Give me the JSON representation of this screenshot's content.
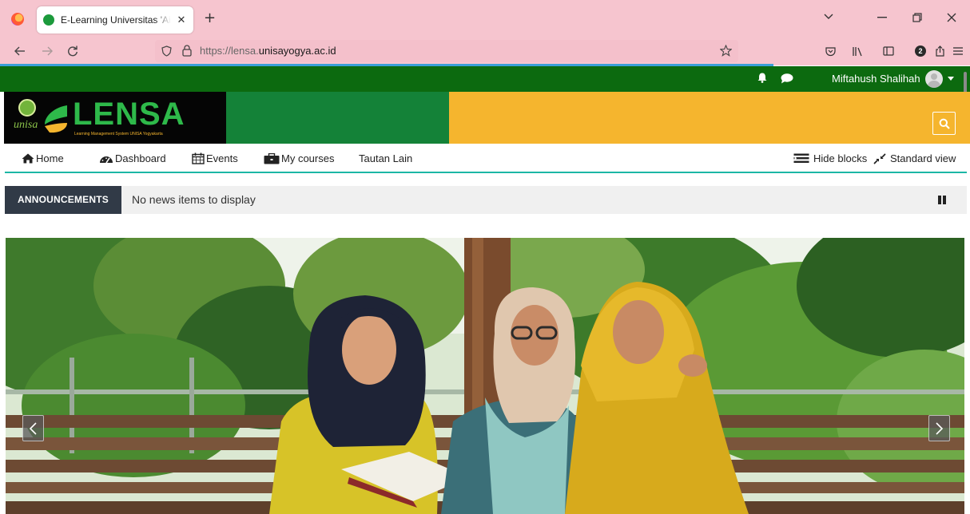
{
  "browser": {
    "tab_title": "E-Learning Universitas 'Aisyiyah Yogyakarta",
    "tab_close": "✕",
    "new_tab": "+",
    "url_prefix": "https://lensa.",
    "url_domain": "unisayogya.ac.id",
    "profile_initial": "2"
  },
  "header": {
    "username": "Miftahush Shalihah",
    "logo_seal_text": "unisa",
    "logo_text": "LENSA",
    "logo_tagline": "Learning Management System UNISA Yogyakarta"
  },
  "nav": {
    "items": [
      {
        "id": "home",
        "label": "Home",
        "icon": "home-icon"
      },
      {
        "id": "dashboard",
        "label": "Dashboard",
        "icon": "dashboard-icon"
      },
      {
        "id": "events",
        "label": "Events",
        "icon": "calendar-icon"
      },
      {
        "id": "my_courses",
        "label": "My courses",
        "icon": "briefcase-icon"
      },
      {
        "id": "tautan",
        "label": "Tautan Lain",
        "icon": ""
      }
    ],
    "hide_blocks": "Hide blocks",
    "standard_view": "Standard view"
  },
  "announcements": {
    "label": "ANNOUNCEMENTS",
    "text": "No news items to display"
  },
  "colors": {
    "top_strip": "#0c6a0f",
    "banner_black": "#050505",
    "banner_green": "#148238",
    "banner_yellow": "#f5b52e",
    "accent_teal": "#1cb7a5",
    "browser_chrome": "#f6c5cf"
  }
}
